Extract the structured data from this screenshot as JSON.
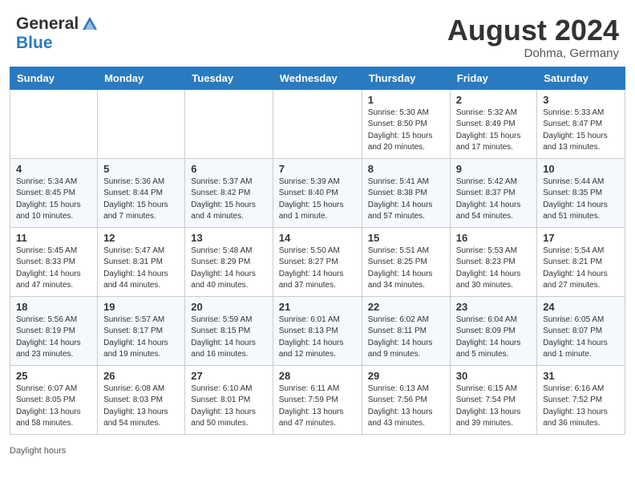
{
  "header": {
    "logo_line1": "General",
    "logo_line2": "Blue",
    "month_year": "August 2024",
    "location": "Dohma, Germany"
  },
  "days_of_week": [
    "Sunday",
    "Monday",
    "Tuesday",
    "Wednesday",
    "Thursday",
    "Friday",
    "Saturday"
  ],
  "weeks": [
    [
      {
        "day": "",
        "info": ""
      },
      {
        "day": "",
        "info": ""
      },
      {
        "day": "",
        "info": ""
      },
      {
        "day": "",
        "info": ""
      },
      {
        "day": "1",
        "info": "Sunrise: 5:30 AM\nSunset: 8:50 PM\nDaylight: 15 hours\nand 20 minutes."
      },
      {
        "day": "2",
        "info": "Sunrise: 5:32 AM\nSunset: 8:49 PM\nDaylight: 15 hours\nand 17 minutes."
      },
      {
        "day": "3",
        "info": "Sunrise: 5:33 AM\nSunset: 8:47 PM\nDaylight: 15 hours\nand 13 minutes."
      }
    ],
    [
      {
        "day": "4",
        "info": "Sunrise: 5:34 AM\nSunset: 8:45 PM\nDaylight: 15 hours\nand 10 minutes."
      },
      {
        "day": "5",
        "info": "Sunrise: 5:36 AM\nSunset: 8:44 PM\nDaylight: 15 hours\nand 7 minutes."
      },
      {
        "day": "6",
        "info": "Sunrise: 5:37 AM\nSunset: 8:42 PM\nDaylight: 15 hours\nand 4 minutes."
      },
      {
        "day": "7",
        "info": "Sunrise: 5:39 AM\nSunset: 8:40 PM\nDaylight: 15 hours\nand 1 minute."
      },
      {
        "day": "8",
        "info": "Sunrise: 5:41 AM\nSunset: 8:38 PM\nDaylight: 14 hours\nand 57 minutes."
      },
      {
        "day": "9",
        "info": "Sunrise: 5:42 AM\nSunset: 8:37 PM\nDaylight: 14 hours\nand 54 minutes."
      },
      {
        "day": "10",
        "info": "Sunrise: 5:44 AM\nSunset: 8:35 PM\nDaylight: 14 hours\nand 51 minutes."
      }
    ],
    [
      {
        "day": "11",
        "info": "Sunrise: 5:45 AM\nSunset: 8:33 PM\nDaylight: 14 hours\nand 47 minutes."
      },
      {
        "day": "12",
        "info": "Sunrise: 5:47 AM\nSunset: 8:31 PM\nDaylight: 14 hours\nand 44 minutes."
      },
      {
        "day": "13",
        "info": "Sunrise: 5:48 AM\nSunset: 8:29 PM\nDaylight: 14 hours\nand 40 minutes."
      },
      {
        "day": "14",
        "info": "Sunrise: 5:50 AM\nSunset: 8:27 PM\nDaylight: 14 hours\nand 37 minutes."
      },
      {
        "day": "15",
        "info": "Sunrise: 5:51 AM\nSunset: 8:25 PM\nDaylight: 14 hours\nand 34 minutes."
      },
      {
        "day": "16",
        "info": "Sunrise: 5:53 AM\nSunset: 8:23 PM\nDaylight: 14 hours\nand 30 minutes."
      },
      {
        "day": "17",
        "info": "Sunrise: 5:54 AM\nSunset: 8:21 PM\nDaylight: 14 hours\nand 27 minutes."
      }
    ],
    [
      {
        "day": "18",
        "info": "Sunrise: 5:56 AM\nSunset: 8:19 PM\nDaylight: 14 hours\nand 23 minutes."
      },
      {
        "day": "19",
        "info": "Sunrise: 5:57 AM\nSunset: 8:17 PM\nDaylight: 14 hours\nand 19 minutes."
      },
      {
        "day": "20",
        "info": "Sunrise: 5:59 AM\nSunset: 8:15 PM\nDaylight: 14 hours\nand 16 minutes."
      },
      {
        "day": "21",
        "info": "Sunrise: 6:01 AM\nSunset: 8:13 PM\nDaylight: 14 hours\nand 12 minutes."
      },
      {
        "day": "22",
        "info": "Sunrise: 6:02 AM\nSunset: 8:11 PM\nDaylight: 14 hours\nand 9 minutes."
      },
      {
        "day": "23",
        "info": "Sunrise: 6:04 AM\nSunset: 8:09 PM\nDaylight: 14 hours\nand 5 minutes."
      },
      {
        "day": "24",
        "info": "Sunrise: 6:05 AM\nSunset: 8:07 PM\nDaylight: 14 hours\nand 1 minute."
      }
    ],
    [
      {
        "day": "25",
        "info": "Sunrise: 6:07 AM\nSunset: 8:05 PM\nDaylight: 13 hours\nand 58 minutes."
      },
      {
        "day": "26",
        "info": "Sunrise: 6:08 AM\nSunset: 8:03 PM\nDaylight: 13 hours\nand 54 minutes."
      },
      {
        "day": "27",
        "info": "Sunrise: 6:10 AM\nSunset: 8:01 PM\nDaylight: 13 hours\nand 50 minutes."
      },
      {
        "day": "28",
        "info": "Sunrise: 6:11 AM\nSunset: 7:59 PM\nDaylight: 13 hours\nand 47 minutes."
      },
      {
        "day": "29",
        "info": "Sunrise: 6:13 AM\nSunset: 7:56 PM\nDaylight: 13 hours\nand 43 minutes."
      },
      {
        "day": "30",
        "info": "Sunrise: 6:15 AM\nSunset: 7:54 PM\nDaylight: 13 hours\nand 39 minutes."
      },
      {
        "day": "31",
        "info": "Sunrise: 6:16 AM\nSunset: 7:52 PM\nDaylight: 13 hours\nand 36 minutes."
      }
    ]
  ],
  "footer": {
    "daylight_label": "Daylight hours"
  }
}
